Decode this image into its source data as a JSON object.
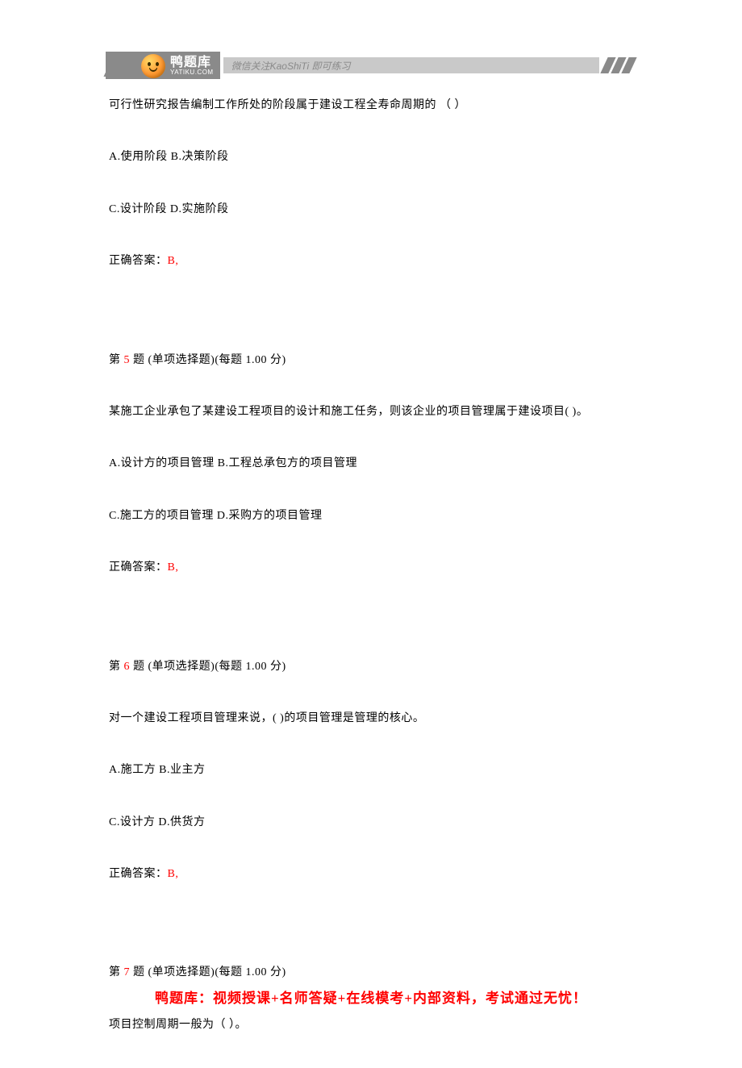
{
  "header": {
    "logo_main": "鸭题库",
    "logo_sub": "YATIKU.COM",
    "banner_text": "微信关注KaoShiTi 即可练习"
  },
  "q4": {
    "stem": "可行性研究报告编制工作所处的阶段属于建设工程全寿命周期的 （ ）",
    "opts_ab": "A.使用阶段 B.决策阶段",
    "opts_cd": "C.设计阶段 D.实施阶段",
    "ans_label": "正确答案：",
    "ans_value": "B,"
  },
  "q5": {
    "header_pre": "第 ",
    "num": "5",
    "header_post": " 题 (单项选择题)(每题 1.00 分)",
    "stem": "某施工企业承包了某建设工程项目的设计和施工任务，则该企业的项目管理属于建设项目( )。",
    "opts_ab": "A.设计方的项目管理 B.工程总承包方的项目管理",
    "opts_cd": "C.施工方的项目管理 D.采购方的项目管理",
    "ans_label": "正确答案：",
    "ans_value": "B,"
  },
  "q6": {
    "header_pre": "第 ",
    "num": "6",
    "header_post": " 题 (单项选择题)(每题 1.00 分)",
    "stem": "对一个建设工程项目管理来说，( )的项目管理是管理的核心。",
    "opts_ab": "A.施工方 B.业主方",
    "opts_cd": "C.设计方 D.供货方",
    "ans_label": "正确答案：",
    "ans_value": "B,"
  },
  "q7": {
    "header_pre": "第 ",
    "num": "7",
    "header_post": " 题 (单项选择题)(每题 1.00 分)",
    "stem": "项目控制周期一般为（  ）。"
  },
  "footer": {
    "text": "鸭题库：视频授课+名师答疑+在线模考+内部资料，考试通过无忧！"
  }
}
